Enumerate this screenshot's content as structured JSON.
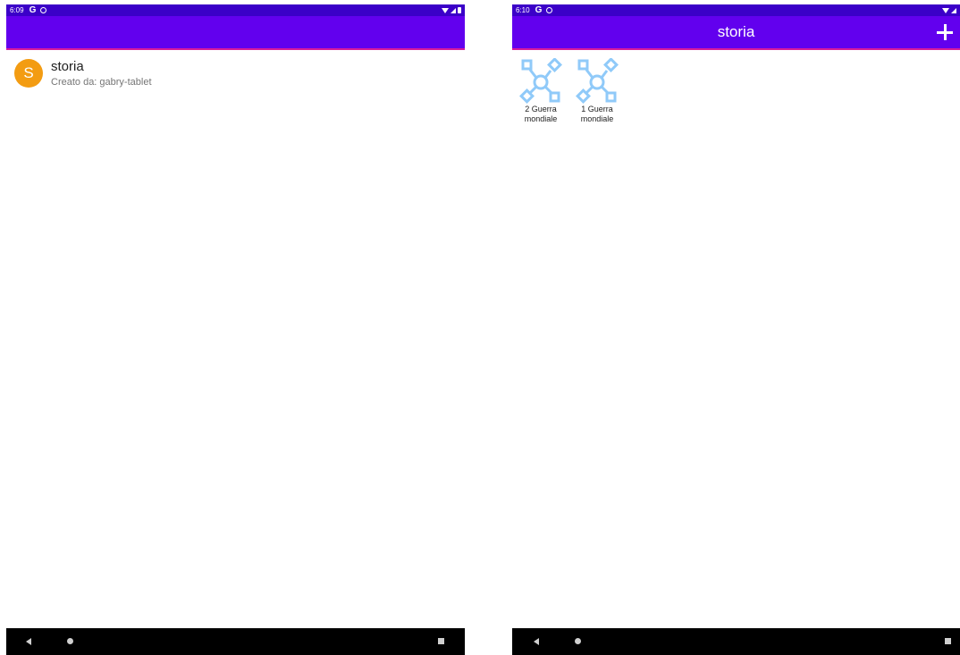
{
  "left": {
    "status": {
      "time": "6:09",
      "g_label": "G"
    },
    "project": {
      "avatar_letter": "S",
      "title": "storia",
      "subtitle": "Creato da: gabry-tablet"
    }
  },
  "right": {
    "status": {
      "time": "6:10",
      "g_label": "G"
    },
    "app_bar": {
      "title": "storia"
    },
    "maps": [
      {
        "line1": "2 Guerra",
        "line2": "mondiale",
        "icon": "mind-map-icon"
      },
      {
        "line1": "1 Guerra",
        "line2": "mondiale",
        "icon": "mind-map-icon"
      }
    ]
  },
  "colors": {
    "status_bar": "#3b00c8",
    "app_bar": "#6200ee",
    "avatar": "#f39c12",
    "map_icon": "#90caf9",
    "nav_bar": "#000000"
  }
}
